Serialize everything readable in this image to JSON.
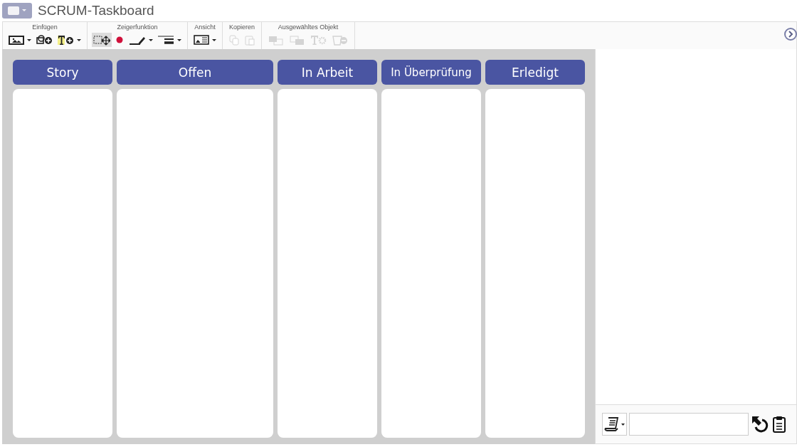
{
  "window": {
    "title": "SCRUM-Taskboard"
  },
  "toolbar": {
    "groups": [
      {
        "label": "Einfügen",
        "tools": [
          {
            "kind": "image",
            "disabled": false,
            "selected": false,
            "dropdown": true
          },
          {
            "kind": "shape-add",
            "disabled": false,
            "selected": false,
            "dropdown": false
          },
          {
            "kind": "text-add",
            "disabled": false,
            "selected": false,
            "dropdown": true
          }
        ]
      },
      {
        "label": "Zeigerfunktion",
        "tools": [
          {
            "kind": "select-move",
            "disabled": false,
            "selected": true,
            "dropdown": false
          },
          {
            "kind": "dot",
            "disabled": false,
            "selected": false,
            "dropdown": false
          },
          {
            "kind": "pen",
            "disabled": false,
            "selected": false,
            "dropdown": true
          },
          {
            "kind": "lines",
            "disabled": false,
            "selected": false,
            "dropdown": true
          }
        ]
      },
      {
        "label": "Ansicht",
        "tools": [
          {
            "kind": "view",
            "disabled": false,
            "selected": false,
            "dropdown": true
          }
        ]
      },
      {
        "label": "Kopieren",
        "tools": [
          {
            "kind": "copy",
            "disabled": true,
            "selected": false,
            "dropdown": false
          },
          {
            "kind": "paste",
            "disabled": true,
            "selected": false,
            "dropdown": false
          }
        ]
      },
      {
        "label": "Ausgewähltes Objekt",
        "tools": [
          {
            "kind": "front",
            "disabled": true,
            "selected": false,
            "dropdown": false
          },
          {
            "kind": "back",
            "disabled": true,
            "selected": false,
            "dropdown": false
          },
          {
            "kind": "text-settings",
            "disabled": true,
            "selected": false,
            "dropdown": false
          },
          {
            "kind": "delete",
            "disabled": true,
            "selected": false,
            "dropdown": false
          }
        ]
      }
    ]
  },
  "board": {
    "columns": [
      {
        "title": "Story"
      },
      {
        "title": "Offen"
      },
      {
        "title": "In Arbeit"
      },
      {
        "title": "In Überprüfung"
      },
      {
        "title": "Erledigt"
      }
    ]
  }
}
